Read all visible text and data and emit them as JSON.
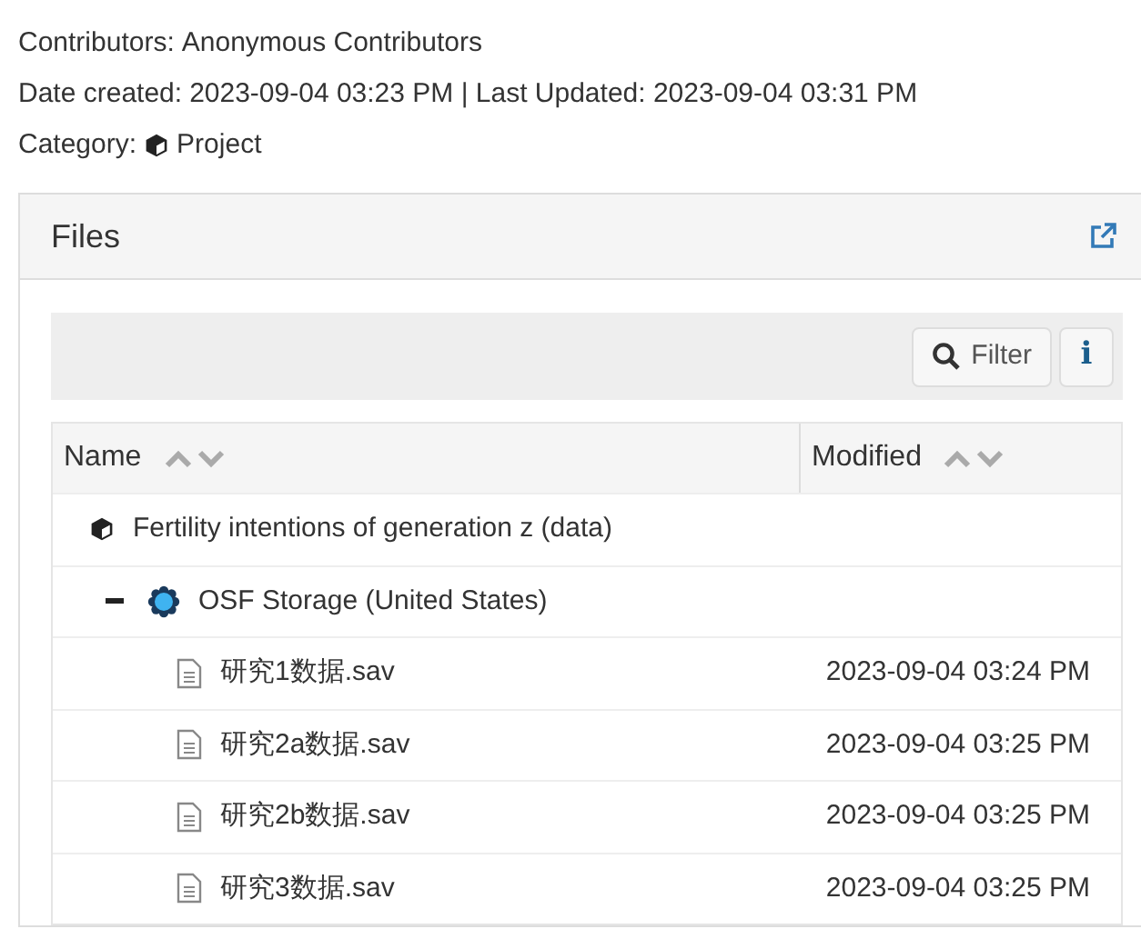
{
  "meta": [
    {
      "label": "Contributors:",
      "value": "Anonymous Contributors"
    },
    {
      "label": "Date created:",
      "value": "2023-09-04 03:23 PM | Last Updated: 2023-09-04 03:31 PM"
    },
    {
      "label": "Category:",
      "value": "Project",
      "kind": "category"
    }
  ],
  "files_panel": {
    "title": "Files",
    "toolbar": {
      "filter_button": "Filter",
      "info_button": "i"
    },
    "table": {
      "columns": [
        "Name",
        "Modified"
      ],
      "rows": [
        {
          "kind": "project",
          "name": "Fertility intentions of generation z (data)",
          "children": [
            {
              "kind": "storage",
              "name": "OSF Storage (United States)",
              "expanded": true,
              "children": [
                {
                  "kind": "file",
                  "name": "研究1数据.sav",
                  "modified": "2023-09-04 03:24 PM"
                },
                {
                  "kind": "file",
                  "name": "研究2a数据.sav",
                  "modified": "2023-09-04 03:25 PM"
                },
                {
                  "kind": "file",
                  "name": "研究2b数据.sav",
                  "modified": "2023-09-04 03:25 PM"
                },
                {
                  "kind": "file",
                  "name": "研究3数据.sav",
                  "modified": "2023-09-04 03:25 PM"
                }
              ]
            }
          ]
        }
      ]
    }
  }
}
